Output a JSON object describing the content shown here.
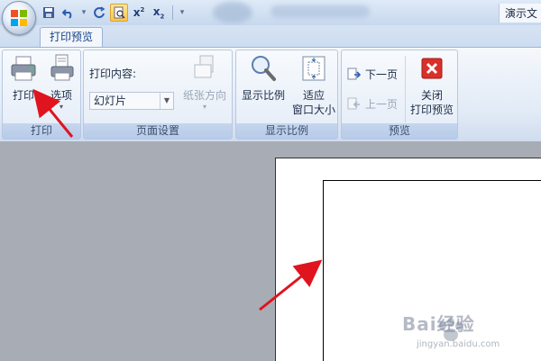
{
  "window": {
    "app_title": "演示文"
  },
  "quick_access": {
    "buttons": [
      "save-icon",
      "undo-icon",
      "redo-icon",
      "print-preview-icon",
      "superscript-icon",
      "subscript-icon",
      "customize-icon"
    ]
  },
  "tabs": [
    {
      "label": "打印预览",
      "active": true
    }
  ],
  "ribbon": {
    "print_group": {
      "label": "打印",
      "print_button": "打印",
      "options_button": "选项"
    },
    "page_setup_group": {
      "label": "页面设置",
      "print_content_label": "打印内容:",
      "print_content_value": "幻灯片",
      "orientation_button": "纸张方向"
    },
    "zoom_group": {
      "label": "显示比例",
      "zoom_button": "显示比例",
      "fit_window_button_line1": "适应",
      "fit_window_button_line2": "窗口大小"
    },
    "preview_group": {
      "label": "预览",
      "next_page": "下一页",
      "prev_page": "上一页",
      "close_line1": "关闭",
      "close_line2": "打印预览"
    }
  },
  "watermark": {
    "brand": "Bai经验",
    "url": "jingyan.baidu.com"
  },
  "colors": {
    "accent": "#15428b",
    "annotation_arrow": "#e0141e",
    "close_red": "#d9302a"
  }
}
